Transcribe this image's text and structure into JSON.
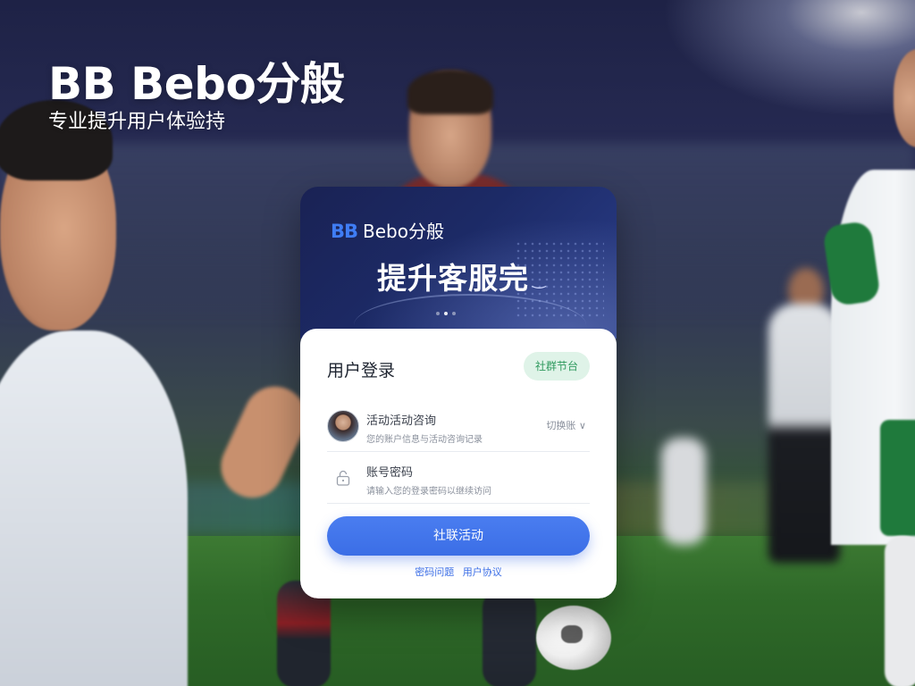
{
  "hero": {
    "title": "BB Bebo分般",
    "subtitle": "专业提升用户体验持"
  },
  "card": {
    "banner": {
      "logo_mark": "BB",
      "logo_text": "Bebo分般",
      "headline": "提升客服完",
      "headline_glyph": "‿",
      "carousel": {
        "count": 3,
        "active_index": 1
      }
    },
    "login": {
      "title": "用户登录",
      "register_label": "社群节台",
      "account": {
        "name": "活动活动咨询",
        "detail": "您的账户信息与活动咨询记录",
        "switch_label": "切换账 ∨"
      },
      "password": {
        "label": "账号密码",
        "hint": "请输入您的登录密码以继续访问"
      },
      "submit_label": "社联活动",
      "links": [
        "密码问题",
        "用户协议"
      ]
    }
  },
  "colors": {
    "accent_blue": "#3b6ee6",
    "register_green": "#2f9a5e",
    "register_bg": "#dff3e8",
    "banner_navy": "#1c2a66"
  },
  "icons": {
    "avatar": "user-avatar",
    "lock": "lock-icon",
    "chevron": "chevron-down-icon"
  }
}
